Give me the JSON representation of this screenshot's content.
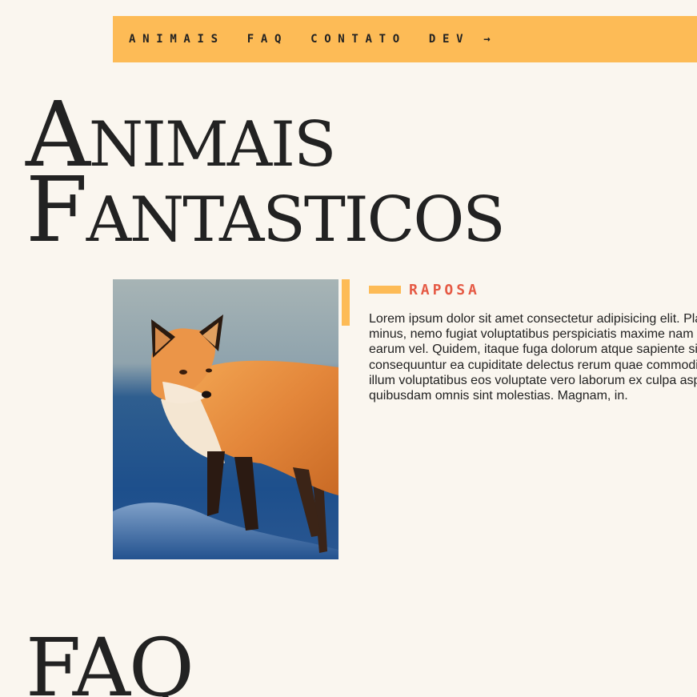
{
  "nav": {
    "items": [
      {
        "label": "ANIMAIS"
      },
      {
        "label": "FAQ"
      },
      {
        "label": "CONTATO"
      },
      {
        "label": "DEV →"
      }
    ]
  },
  "hero": {
    "title_line1": "Animais",
    "title_line2": "Fantasticos"
  },
  "animal": {
    "image_alt": "Raposa",
    "name": "RAPOSA",
    "description_lines": [
      "Lorem ipsum dolor sit amet consectetur adipisicing elit. Pla",
      "minus, nemo fugiat voluptatibus perspiciatis maxime nam",
      "earum vel. Quidem, itaque fuga dolorum atque sapiente si",
      "consequuntur ea cupiditate delectus rerum quae commodi",
      "illum voluptatibus eos voluptate vero laborum ex culpa asp",
      "quibusdam omnis sint molestias. Magnam, in."
    ]
  },
  "faq": {
    "title": "FAQ"
  },
  "colors": {
    "background": "#faf6ef",
    "accent": "#fdbb56",
    "heading_red": "#e55a45",
    "text": "#222222"
  }
}
